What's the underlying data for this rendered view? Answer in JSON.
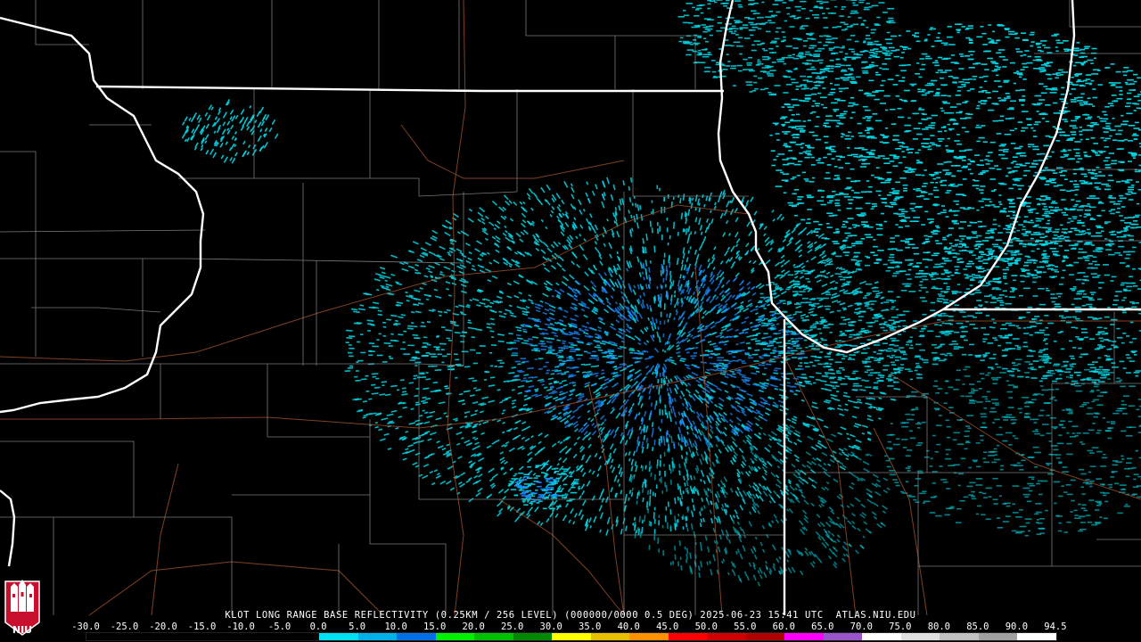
{
  "title": "KLOT LONG RANGE BASE REFLECTIVITY (0.25KM / 256 LEVEL) (000000/0000 0.5 DEG) 2025-06-23 15:41 UTC  ATLAS.NIU.EDU",
  "logo_text": "NIU",
  "scale": {
    "labels": [
      "-30.0",
      "-25.0",
      "-20.0",
      "-15.0",
      "-10.0",
      "-5.0",
      "0.0",
      "5.0",
      "10.0",
      "15.0",
      "20.0",
      "25.0",
      "30.0",
      "35.0",
      "40.0",
      "45.0",
      "50.0",
      "55.0",
      "60.0",
      "65.0",
      "70.0",
      "75.0",
      "80.0",
      "85.0",
      "90.0",
      "94.5"
    ],
    "colors": [
      "#000000",
      "#000000",
      "#000000",
      "#000000",
      "#000000",
      "#000000",
      "#00e0f0",
      "#00b0e8",
      "#0070e8",
      "#00f000",
      "#00c000",
      "#008800",
      "#ffff00",
      "#e8c000",
      "#ff9000",
      "#ff0000",
      "#d00000",
      "#b00000",
      "#ff00ff",
      "#9955c9",
      "#ffffff",
      "#e0e0e0",
      "#c0c0c0",
      "#a0a0a0",
      "#ffffff"
    ]
  },
  "colors": {
    "echo_primary": "#00d8e8",
    "echo_dense": "#1a8cff",
    "state_border": "#ffffff",
    "county_line": "#9a9a9a",
    "road": "#a0522d"
  }
}
